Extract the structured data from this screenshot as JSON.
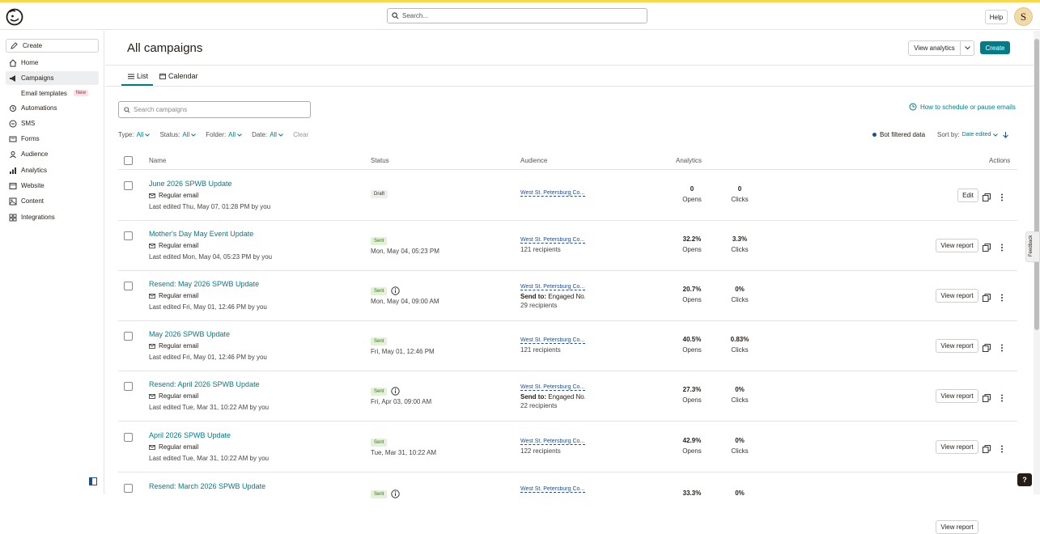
{
  "topbar": {
    "search_placeholder": "Search...",
    "help_label": "Help",
    "avatar_initial": "S"
  },
  "sidebar": {
    "create_label": "Create",
    "items": [
      {
        "label": "Home",
        "icon": "home-icon"
      },
      {
        "label": "Campaigns",
        "icon": "megaphone-icon",
        "active": true
      },
      {
        "label": "Automations",
        "icon": "automation-icon"
      },
      {
        "label": "SMS",
        "icon": "sms-icon"
      },
      {
        "label": "Forms",
        "icon": "forms-icon"
      },
      {
        "label": "Audience",
        "icon": "audience-icon"
      },
      {
        "label": "Analytics",
        "icon": "analytics-icon"
      },
      {
        "label": "Website",
        "icon": "website-icon"
      },
      {
        "label": "Content",
        "icon": "content-icon"
      },
      {
        "label": "Integrations",
        "icon": "integrations-icon"
      }
    ],
    "sub_item": {
      "label": "Email templates",
      "badge": "New"
    }
  },
  "header": {
    "title": "All campaigns",
    "view_analytics_label": "View analytics",
    "create_label": "Create"
  },
  "tabs": [
    {
      "label": "List",
      "active": true
    },
    {
      "label": "Calendar"
    }
  ],
  "search": {
    "placeholder": "Search campaigns"
  },
  "help_link": "How to schedule or pause emails",
  "filters": {
    "type_label": "Type:",
    "type_value": "All",
    "status_label": "Status:",
    "status_value": "All",
    "folder_label": "Folder:",
    "folder_value": "All",
    "date_label": "Date:",
    "date_value": "All",
    "clear_label": "Clear",
    "bot_filtered": "Bot filtered data",
    "sort_label": "Sort by:",
    "sort_value": "Date edited"
  },
  "table": {
    "headers": {
      "name": "Name",
      "status": "Status",
      "audience": "Audience",
      "analytics": "Analytics",
      "actions": "Actions"
    },
    "rows": [
      {
        "name": "June 2026 SPWB Update",
        "type": "Regular email",
        "edited": "Last edited Thu, May 07, 01:28 PM by you",
        "status": "Draft",
        "status_kind": "draft",
        "info": false,
        "date": "",
        "audience": "West St. Petersburg Co...",
        "send_to": "",
        "recipients": "",
        "opens": "0",
        "opens_label": "Opens",
        "clicks": "0",
        "clicks_label": "Clicks",
        "action": "Edit"
      },
      {
        "name": "Mother's Day May Event Update",
        "type": "Regular email",
        "edited": "Last edited Mon, May 04, 05:23 PM by you",
        "status": "Sent",
        "status_kind": "sent",
        "info": false,
        "date": "Mon, May 04, 05:23 PM",
        "audience": "West St. Petersburg Co...",
        "send_to": "",
        "recipients": "121 recipients",
        "opens": "32.2%",
        "opens_label": "Opens",
        "clicks": "3.3%",
        "clicks_label": "Clicks",
        "action": "View report"
      },
      {
        "name": "Resend: May 2026 SPWB Update",
        "type": "Regular email",
        "edited": "Last edited Fri, May 01, 12:46 PM by you",
        "status": "Sent",
        "status_kind": "sent",
        "info": true,
        "date": "Mon, May 04, 09:00 AM",
        "audience": "West St. Petersburg Co...",
        "send_to_label": "Send to:",
        "send_to": "Engaged No...",
        "recipients": "29 recipients",
        "opens": "20.7%",
        "opens_label": "Opens",
        "clicks": "0%",
        "clicks_label": "Clicks",
        "action": "View report"
      },
      {
        "name": "May 2026 SPWB Update",
        "type": "Regular email",
        "edited": "Last edited Fri, May 01, 12:46 PM by you",
        "status": "Sent",
        "status_kind": "sent",
        "info": false,
        "date": "Fri, May 01, 12:46 PM",
        "audience": "West St. Petersburg Co...",
        "send_to": "",
        "recipients": "121 recipients",
        "opens": "40.5%",
        "opens_label": "Opens",
        "clicks": "0.83%",
        "clicks_label": "Clicks",
        "action": "View report"
      },
      {
        "name": "Resend: April 2026 SPWB Update",
        "type": "Regular email",
        "edited": "Last edited Tue, Mar 31, 10:22 AM by you",
        "status": "Sent",
        "status_kind": "sent",
        "info": true,
        "date": "Fri, Apr 03, 09:00 AM",
        "audience": "West St. Petersburg Co...",
        "send_to_label": "Send to:",
        "send_to": "Engaged No...",
        "recipients": "22 recipients",
        "opens": "27.3%",
        "opens_label": "Opens",
        "clicks": "0%",
        "clicks_label": "Clicks",
        "action": "View report"
      },
      {
        "name": "April 2026 SPWB Update",
        "type": "Regular email",
        "edited": "Last edited Tue, Mar 31, 10:22 AM by you",
        "status": "Sent",
        "status_kind": "sent",
        "info": false,
        "date": "Tue, Mar 31, 10:22 AM",
        "audience": "West St. Petersburg Co...",
        "send_to": "",
        "recipients": "122 recipients",
        "opens": "42.9%",
        "opens_label": "Opens",
        "clicks": "0%",
        "clicks_label": "Clicks",
        "action": "View report"
      },
      {
        "name": "Resend: March 2026 SPWB Update",
        "type": "",
        "edited": "",
        "status": "Sent",
        "status_kind": "sent",
        "info": true,
        "date": "",
        "audience": "West St. Petersburg Co...",
        "send_to": "",
        "recipients": "",
        "opens": "33.3%",
        "opens_label": "",
        "clicks": "0%",
        "clicks_label": "",
        "action": "View report"
      }
    ]
  },
  "feedback_label": "Feedback",
  "help_fab": "?",
  "colors": {
    "accent": "#007c89",
    "sent_bg": "#e3f1d8",
    "draft_bg": "#efeeea",
    "link_blue": "#1f4e8c",
    "brand_yellow": "#f7d84b"
  }
}
